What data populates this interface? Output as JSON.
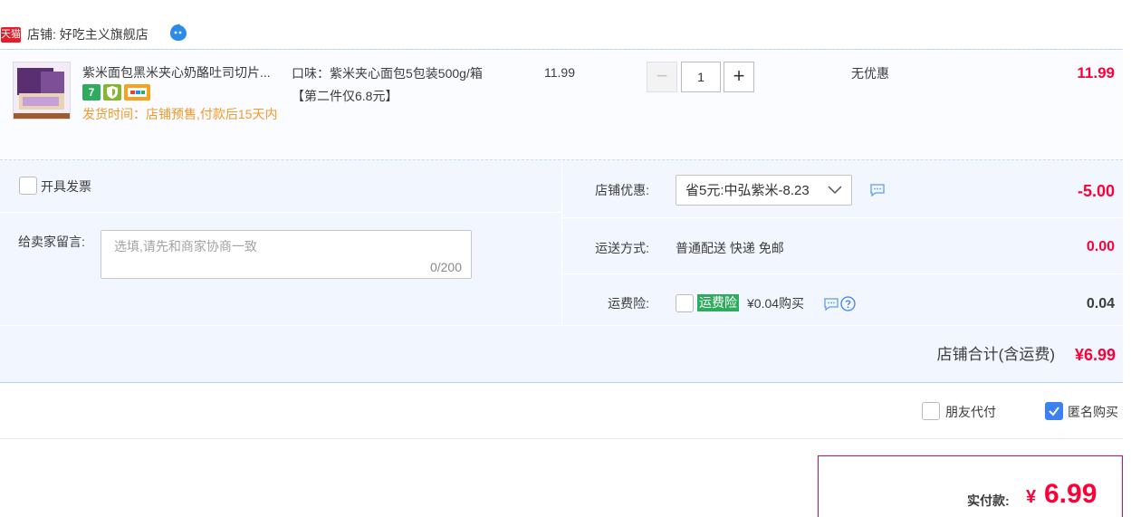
{
  "shop": {
    "badge": "天猫",
    "label": "店铺: 好吃主义旗舰店"
  },
  "item": {
    "title": "紫米面包黑米夹心奶酪吐司切片...",
    "service_icons": [
      "seven-day-return-icon",
      "shield-icon",
      "card-icon"
    ],
    "seven_label": "7",
    "ship_time": "发货时间：店铺预售,付款后15天内",
    "sku": "口味：紫米夹心面包5包装500g/箱【第二件仅6.8元】",
    "unit_price": "11.99",
    "quantity": "1",
    "minus_label": "−",
    "plus_label": "+",
    "discount": "无优惠",
    "total": "11.99"
  },
  "options": {
    "invoice_label": "开具发票",
    "message_label": "给卖家留言:",
    "message_placeholder": "选填,请先和商家协商一致",
    "message_count": "0/200",
    "coupon_label": "店铺优惠:",
    "coupon_value": "省5元:中弘紫米-8.23",
    "coupon_amount": "-5.00",
    "shipping_label": "运送方式:",
    "shipping_value": "普通配送 快递 免邮",
    "shipping_amount": "0.00",
    "insurance_label": "运费险:",
    "insurance_badge": "运费险",
    "insurance_text": "¥0.04购买",
    "insurance_amount": "0.04"
  },
  "summary": {
    "subtotal_label": "店铺合计(含运费)",
    "subtotal_amount": "¥6.99",
    "friend_pay_label": "朋友代付",
    "anonymous_label": "匿名购买",
    "pay_label": "实付款:",
    "pay_currency": "¥",
    "pay_amount": "6.99"
  },
  "colors": {
    "price_red": "#ff0036",
    "accent_blue": "#3d80f0",
    "ship_orange": "#f09a2b",
    "service_green": "#2eab5d"
  }
}
